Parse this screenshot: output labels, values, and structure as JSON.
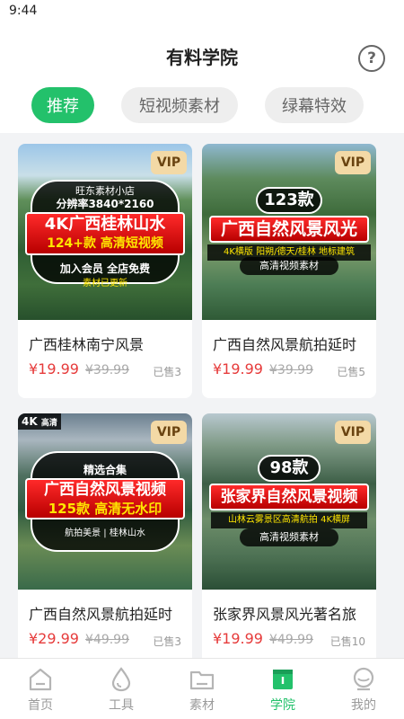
{
  "status_bar": {
    "time": "9:44"
  },
  "header": {
    "title": "有料学院",
    "help_icon": "question-circle-icon"
  },
  "tabs": [
    {
      "label": "推荐",
      "active": true
    },
    {
      "label": "短视频素材",
      "active": false
    },
    {
      "label": "绿幕特效",
      "active": false
    }
  ],
  "cards": [
    {
      "title": "广西桂林南宁风景",
      "price": "¥19.99",
      "old_price": "¥39.99",
      "sold": "已售3",
      "badge": "VIP",
      "thumb": {
        "line1": "旺东素材小店",
        "line2": "分辨率3840*2160",
        "headline": "4K广西桂林山水",
        "subline": "124+款 高清短视频",
        "line3": "加入会员 全店免费",
        "line4": "素材已更新"
      }
    },
    {
      "title": "广西自然风景航拍延时",
      "price": "¥19.99",
      "old_price": "¥39.99",
      "sold": "已售5",
      "badge": "VIP",
      "thumb": {
        "count": "123款",
        "headline": "广西自然风景风光",
        "subline": "4K横版 阳朔/德天/桂林 地标建筑",
        "footer": "高清视频素材"
      }
    },
    {
      "title": "广西自然风景航拍延时",
      "price": "¥29.99",
      "old_price": "¥49.99",
      "sold": "已售3",
      "badge": "VIP",
      "thumb": {
        "tag": "4K",
        "tag2": "高清",
        "top": "精选合集",
        "headline": "广西自然风景视频",
        "subline": "125款 高清无水印",
        "bottom": "航拍美景 | 桂林山水"
      }
    },
    {
      "title": "张家界风景风光著名旅",
      "price": "¥19.99",
      "old_price": "¥49.99",
      "sold": "已售10",
      "badge": "VIP",
      "thumb": {
        "count": "98款",
        "headline": "张家界自然风景视频",
        "subline": "山林云雾景区高清航拍 4K横屏",
        "footer": "高清视频素材"
      }
    }
  ],
  "bottom_nav": [
    {
      "label": "首页",
      "icon": "home-icon",
      "active": false
    },
    {
      "label": "工具",
      "icon": "drop-icon",
      "active": false
    },
    {
      "label": "素材",
      "icon": "folder-icon",
      "active": false
    },
    {
      "label": "学院",
      "icon": "book-icon",
      "active": true
    },
    {
      "label": "我的",
      "icon": "user-icon",
      "active": false
    }
  ],
  "colors": {
    "accent": "#23c16b",
    "price": "#e63b3b",
    "vip_bg": "#f3d9a6"
  }
}
